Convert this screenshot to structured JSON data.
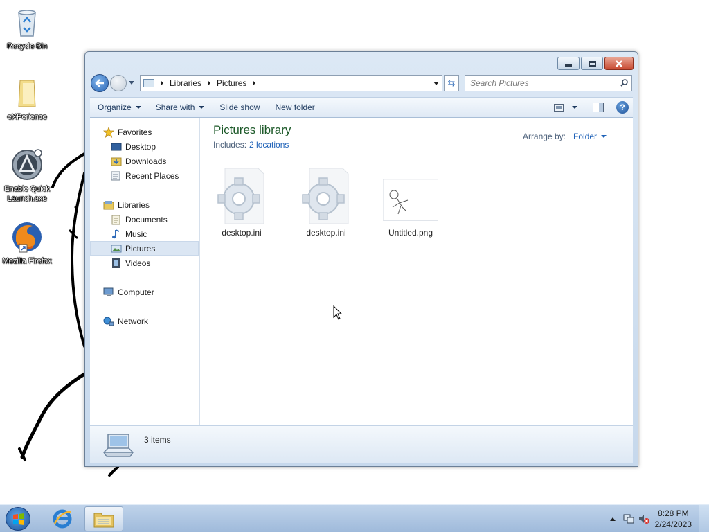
{
  "desktop": {
    "icons": [
      {
        "label": "Recycle Bin",
        "icon": "recycle-bin-icon"
      },
      {
        "label": "eXPerience",
        "icon": "folder-icon"
      },
      {
        "label": "Enable Quick Launch.exe",
        "icon": "quick-launch-icon"
      },
      {
        "label": "Mozilla Firefox",
        "icon": "firefox-icon"
      }
    ]
  },
  "window": {
    "address": {
      "crumbs": [
        "Libraries",
        "Pictures"
      ]
    },
    "search": {
      "placeholder": "Search Pictures"
    },
    "toolbar": {
      "organize": "Organize",
      "share_with": "Share with",
      "slide_show": "Slide show",
      "new_folder": "New folder"
    },
    "nav": {
      "favorites": "Favorites",
      "desktop": "Desktop",
      "downloads": "Downloads",
      "recent_places": "Recent Places",
      "libraries": "Libraries",
      "documents": "Documents",
      "music": "Music",
      "pictures": "Pictures",
      "videos": "Videos",
      "computer": "Computer",
      "network": "Network"
    },
    "content": {
      "title": "Pictures library",
      "includes_label": "Includes:",
      "locations_link": "2 locations",
      "arrange_label": "Arrange by:",
      "arrange_value": "Folder",
      "files": [
        {
          "name": "desktop.ini",
          "icon": "settings-file-icon"
        },
        {
          "name": "desktop.ini",
          "icon": "settings-file-icon"
        },
        {
          "name": "Untitled.png",
          "icon": "image-thumbnail"
        }
      ]
    },
    "details": {
      "item_count": "3 items"
    }
  },
  "taskbar": {
    "time": "8:28 PM",
    "date": "2/24/2023"
  },
  "colors": {
    "library_title": "#1e5a2a",
    "link": "#1f62b8",
    "close_button": "#c84a31"
  }
}
